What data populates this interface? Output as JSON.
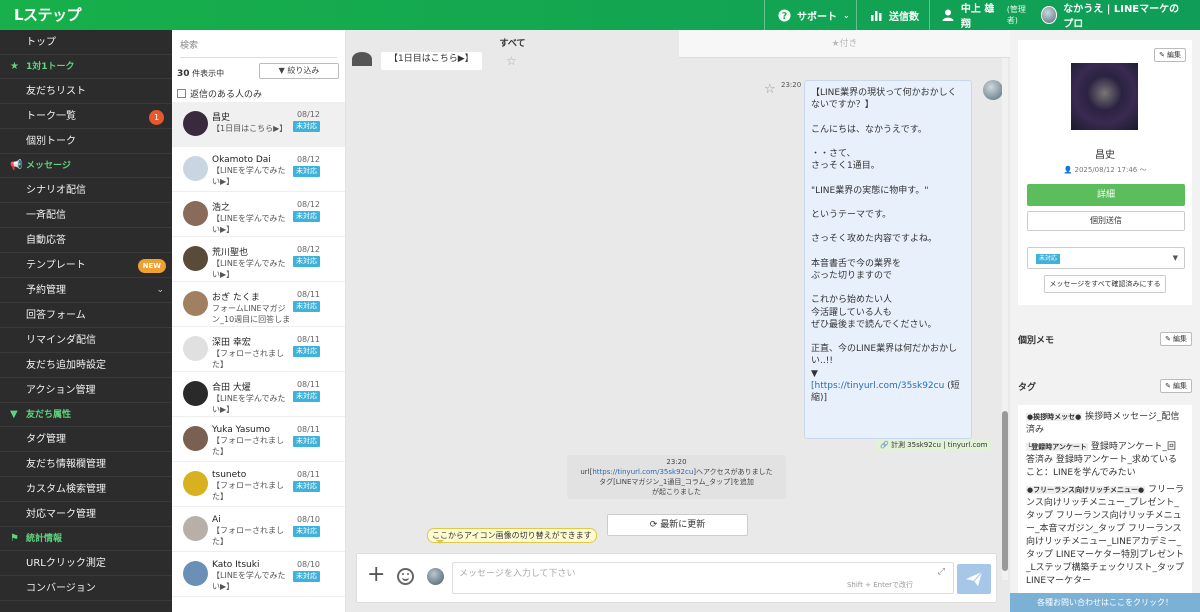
{
  "header": {
    "logo": "Lステップ",
    "support_label": "サポート",
    "sent_count_label": "送信数",
    "user_name": "中上 雄翔",
    "user_role": "(管理者)",
    "account_name": "なかうえ | LINEマーケのプロ"
  },
  "sidebar": {
    "items": [
      {
        "type": "item",
        "label": "トップ"
      },
      {
        "type": "section",
        "label": "1対1トーク",
        "icon": "star-icon"
      },
      {
        "type": "item",
        "label": "友だちリスト"
      },
      {
        "type": "item",
        "label": "トーク一覧",
        "badge": "1"
      },
      {
        "type": "item",
        "label": "個別トーク"
      },
      {
        "type": "section",
        "label": "メッセージ",
        "icon": "megaphone-icon"
      },
      {
        "type": "item",
        "label": "シナリオ配信"
      },
      {
        "type": "item",
        "label": "一斉配信"
      },
      {
        "type": "item",
        "label": "自動応答"
      },
      {
        "type": "item",
        "label": "テンプレート",
        "new_badge": "NEW"
      },
      {
        "type": "item",
        "label": "予約管理",
        "chevron": true
      },
      {
        "type": "item",
        "label": "回答フォーム"
      },
      {
        "type": "item",
        "label": "リマインダ配信"
      },
      {
        "type": "item",
        "label": "友だち追加時設定"
      },
      {
        "type": "item",
        "label": "アクション管理"
      },
      {
        "type": "section",
        "label": "友だち属性",
        "icon": "filter-icon"
      },
      {
        "type": "item",
        "label": "タグ管理"
      },
      {
        "type": "item",
        "label": "友だち情報欄管理"
      },
      {
        "type": "item",
        "label": "カスタム検索管理"
      },
      {
        "type": "item",
        "label": "対応マーク管理"
      },
      {
        "type": "section",
        "label": "統計情報",
        "icon": "flag-icon"
      },
      {
        "type": "item",
        "label": "URLクリック測定"
      },
      {
        "type": "item",
        "label": "コンバージョン"
      }
    ]
  },
  "chat_list": {
    "search_placeholder": "検索",
    "count_number": "30",
    "count_suffix": "件表示中",
    "filter_label": "絞り込み",
    "unread_only_label": "返信のある人のみ",
    "items": [
      {
        "name": "昌史",
        "preview": "【1日目はこちら▶】",
        "date": "08/12",
        "status": "未対応",
        "avatar_color": "#3a2a3e",
        "selected": true
      },
      {
        "name": "Okamoto Dai",
        "preview": "【LINEを学んでみたい▶】",
        "date": "08/12",
        "status": "未対応",
        "avatar_color": "#c9d6e2"
      },
      {
        "name": "浩之",
        "preview": "【LINEを学んでみたい▶】",
        "date": "08/12",
        "status": "未対応",
        "avatar_color": "#8a6a5a"
      },
      {
        "name": "荒川聖也",
        "preview": "【LINEを学んでみたい▶】",
        "date": "08/12",
        "status": "未対応",
        "avatar_color": "#5a4a3a"
      },
      {
        "name": "おぎ たくま",
        "preview": "フォームLINEマガジン_10週目に回答しまし",
        "date": "08/11",
        "status": "未対応",
        "avatar_color": "#a08060"
      },
      {
        "name": "深田 幸宏",
        "preview": "【フォローされました】",
        "date": "08/11",
        "status": "未対応",
        "avatar_color": "#e0e0e0"
      },
      {
        "name": "合田 大燿",
        "preview": "【LINEを学んでみたい▶】",
        "date": "08/11",
        "status": "未対応",
        "avatar_color": "#2a2a2a"
      },
      {
        "name": "Yuka Yasumo",
        "preview": "【フォローされました】",
        "date": "08/11",
        "status": "未対応",
        "avatar_color": "#7a6050"
      },
      {
        "name": "tsuneto",
        "preview": "【フォローされました】",
        "date": "08/11",
        "status": "未対応",
        "avatar_color": "#d8b020"
      },
      {
        "name": "Ai",
        "preview": "【フォローされました】",
        "date": "08/10",
        "status": "未対応",
        "avatar_color": "#b8b0a8"
      },
      {
        "name": "Kato Itsuki",
        "preview": "【LINEを学んでみたい▶】",
        "date": "08/10",
        "status": "未対応",
        "avatar_color": "#6a90b8"
      }
    ]
  },
  "chat": {
    "tab_all": "すべて",
    "tab_starred": "★付き",
    "prev_message": "【1日目はこちら▶】",
    "message_time": "23:20",
    "message_body": "【LINE業界の現状って何かおかしくないですか？】\n\nこんにちは、なかうえです。\n\n・・さて、\nさっそく1通目。\n\n\"LINE業界の実態に物申す。\"\n\nというテーマです。\n\nさっそく攻めた内容ですよね。\n\n本音書舌で今の業界を\nぶった切りますので\n\nこれから始めたい人\n今活躍している人も\nぜひ最後まで読んでください。\n\n正直、今のLINE業界は何だかおかしい..!!\n▼",
    "message_link": "[https://tinyurl.com/35sk92cu",
    "message_link_suffix": " (短縮)]",
    "link_caption": "🔗 計測 35sk92cu | tinyurl.com",
    "system_time": "23:20",
    "system_prefix": "url[",
    "system_link": "https://tinyurl.com/35sk92cu",
    "system_rest": "]へアクセスがありました\nタグ[LINEマガジン_1通目_コラム_タップ]を追加\nが起こりました",
    "refresh_label": "最新に更新",
    "tooltip": "ここからアイコン画像の切り替えができます",
    "input_placeholder": "メッセージを入力して下さい",
    "input_hint": "Shift + Enterで改行"
  },
  "profile": {
    "edit_label": "編集",
    "name": "昌史",
    "date": "2025/08/12 17:46 〜",
    "detail_button": "詳細",
    "individual_send_button": "個別送信",
    "status_value": "未対応",
    "mark_all_read_button": "メッセージをすべて確認済みにする",
    "memo_heading": "個別メモ",
    "tag_heading": "タグ",
    "tag_groups": [
      {
        "group": "●挨拶時メッセ●",
        "text": "挨拶時メッセージ_配信済み"
      },
      {
        "group": "└登録時アンケート",
        "text": "登録時アンケート_回答済み 登録時アンケート_求めていること：LINEを学んでみたい"
      },
      {
        "group": "●フリーランス向けリッチメニュー●",
        "text": "フリーランス向けリッチメニュー_プレゼント_タップ フリーランス向けリッチメニュー_本音マガジン_タップ フリーランス向けリッチメニュー_LINEアカデミー_タップ LINEマーケター特別プレゼント_Lステップ構築チェックリスト_タップ LINEマーケター"
      }
    ]
  },
  "contact_button": "各種お問い合わせはここをクリック！",
  "colors": {
    "brand_green": "#17b04a",
    "status_blue": "#3fb2d9",
    "badge_orange": "#e8582a"
  }
}
